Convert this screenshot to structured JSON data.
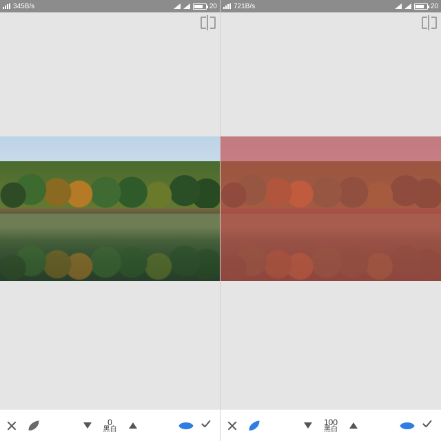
{
  "panes": [
    {
      "status": {
        "speed": "345B/s",
        "time": "20",
        "battery_pct": 62
      },
      "mask_visible": false,
      "slider": {
        "value": "0",
        "label": "黑白"
      },
      "tool_active": "eye"
    },
    {
      "status": {
        "speed": "721B/s",
        "time": "20",
        "battery_pct": 62
      },
      "mask_visible": true,
      "slider": {
        "value": "100",
        "label": "黑白"
      },
      "tool_active": "leaf"
    }
  ],
  "icons": {
    "close": "close-icon",
    "leaf": "leaf-icon",
    "down": "arrow-down-icon",
    "up": "arrow-up-icon",
    "eye": "eye-icon",
    "apply": "apply-icon",
    "compare": "compare-icon"
  }
}
